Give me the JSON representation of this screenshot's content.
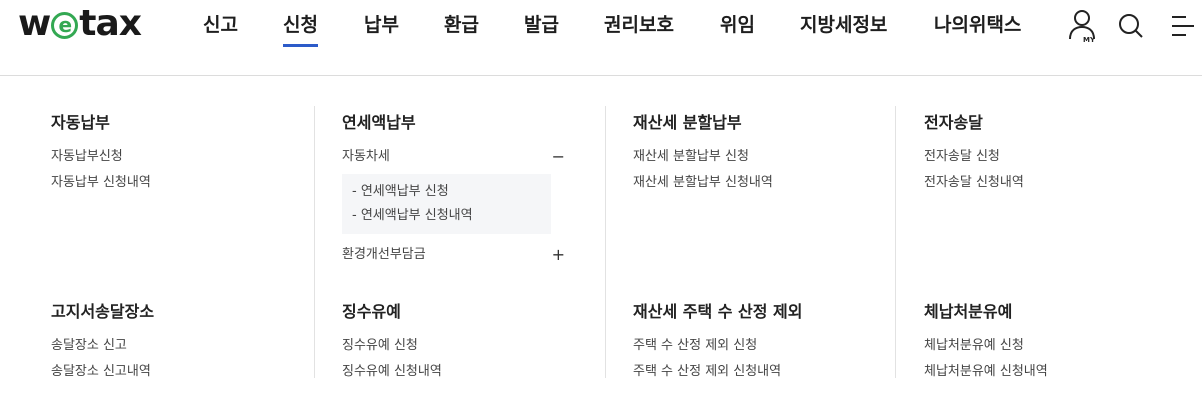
{
  "brand": {
    "logo_w": "w",
    "logo_e": "e",
    "logo_rest": "tax"
  },
  "gnb": {
    "items": [
      {
        "label": "신고"
      },
      {
        "label": "신청",
        "active": true
      },
      {
        "label": "납부"
      },
      {
        "label": "환급"
      },
      {
        "label": "발급"
      },
      {
        "label": "권리보호"
      },
      {
        "label": "위임"
      },
      {
        "label": "지방세정보"
      },
      {
        "label": "나의위택스"
      }
    ]
  },
  "util": {
    "my_label": "MY"
  },
  "menu": {
    "col1": {
      "group1": {
        "title": "자동납부",
        "links": [
          "자동납부신청",
          "자동납부 신청내역"
        ]
      },
      "group2": {
        "title": "고지서송달장소",
        "links": [
          "송달장소 신고",
          "송달장소 신고내역"
        ]
      }
    },
    "col2": {
      "group1": {
        "title": "연세액납부",
        "toggle1": {
          "label": "자동차세",
          "sign": "−",
          "sublinks": [
            "- 연세액납부 신청",
            "- 연세액납부 신청내역"
          ]
        },
        "toggle2": {
          "label": "환경개선부담금",
          "sign": "+"
        }
      },
      "group2": {
        "title": "징수유예",
        "links": [
          "징수유예 신청",
          "징수유예 신청내역"
        ]
      }
    },
    "col3": {
      "group1": {
        "title": "재산세 분할납부",
        "links": [
          "재산세 분할납부 신청",
          "재산세 분할납부 신청내역"
        ]
      },
      "group2": {
        "title": "재산세 주택 수 산정 제외",
        "links": [
          "주택 수 산정 제외 신청",
          "주택 수 산정 제외 신청내역"
        ]
      }
    },
    "col4": {
      "group1": {
        "title": "전자송달",
        "links": [
          "전자송달 신청",
          "전자송달 신청내역"
        ]
      },
      "group2": {
        "title": "체납처분유예",
        "links": [
          "체납처분유예 신청",
          "체납처분유예 신청내역"
        ]
      }
    }
  },
  "colors": {
    "accent": "#2c5bc9",
    "logo_green": "#33a852"
  }
}
